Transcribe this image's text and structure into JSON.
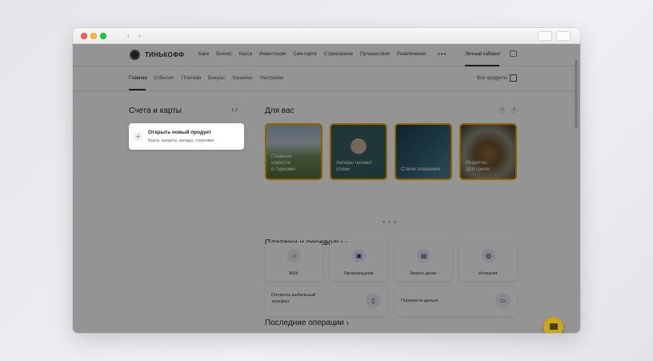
{
  "header": {
    "logo": "ТИНЬКОФФ",
    "nav": [
      "Банк",
      "Бизнес",
      "Касса",
      "Инвестиции",
      "Сим-карта",
      "Страхование",
      "Путешествия",
      "Развлечения"
    ],
    "more": "•••",
    "cabinet": "Личный кабинет"
  },
  "subnav": {
    "tabs": [
      "Главная",
      "События",
      "Платежи",
      "Бонусы",
      "Кошелек",
      "Настройки"
    ],
    "active": "Главная",
    "all_products": "Все продукты"
  },
  "accounts": {
    "title": "Счета и карты",
    "counter": "1.3",
    "new_product_title": "Открыть новый продукт",
    "new_product_sub": "Карты, кредиты, вклады, страховки"
  },
  "for_you": {
    "title": "Для вас",
    "stories": [
      {
        "caption_1": "Главные",
        "caption_2": "новости",
        "caption_3": "о туризме"
      },
      {
        "caption_1": "Актеры читают",
        "caption_2": "стихи",
        "caption_3": ""
      },
      {
        "caption_1": "Стили плавания",
        "caption_2": "",
        "caption_3": ""
      },
      {
        "caption_1": "Рецепты",
        "caption_2": "для гриля",
        "caption_3": ""
      }
    ]
  },
  "payments": {
    "title": "Платежи и переводы ›",
    "tiles": [
      "ЖКХ",
      "Организациям",
      "Запрос денег",
      "Интернет"
    ],
    "mobile_1": "Оплатить мобильный",
    "mobile_2": "телефон",
    "transfer": "Перевести деньги"
  },
  "operations": {
    "title": "Последние операции ›"
  },
  "icons": {
    "accent": "#f2a900",
    "chat": "chat-icon"
  }
}
